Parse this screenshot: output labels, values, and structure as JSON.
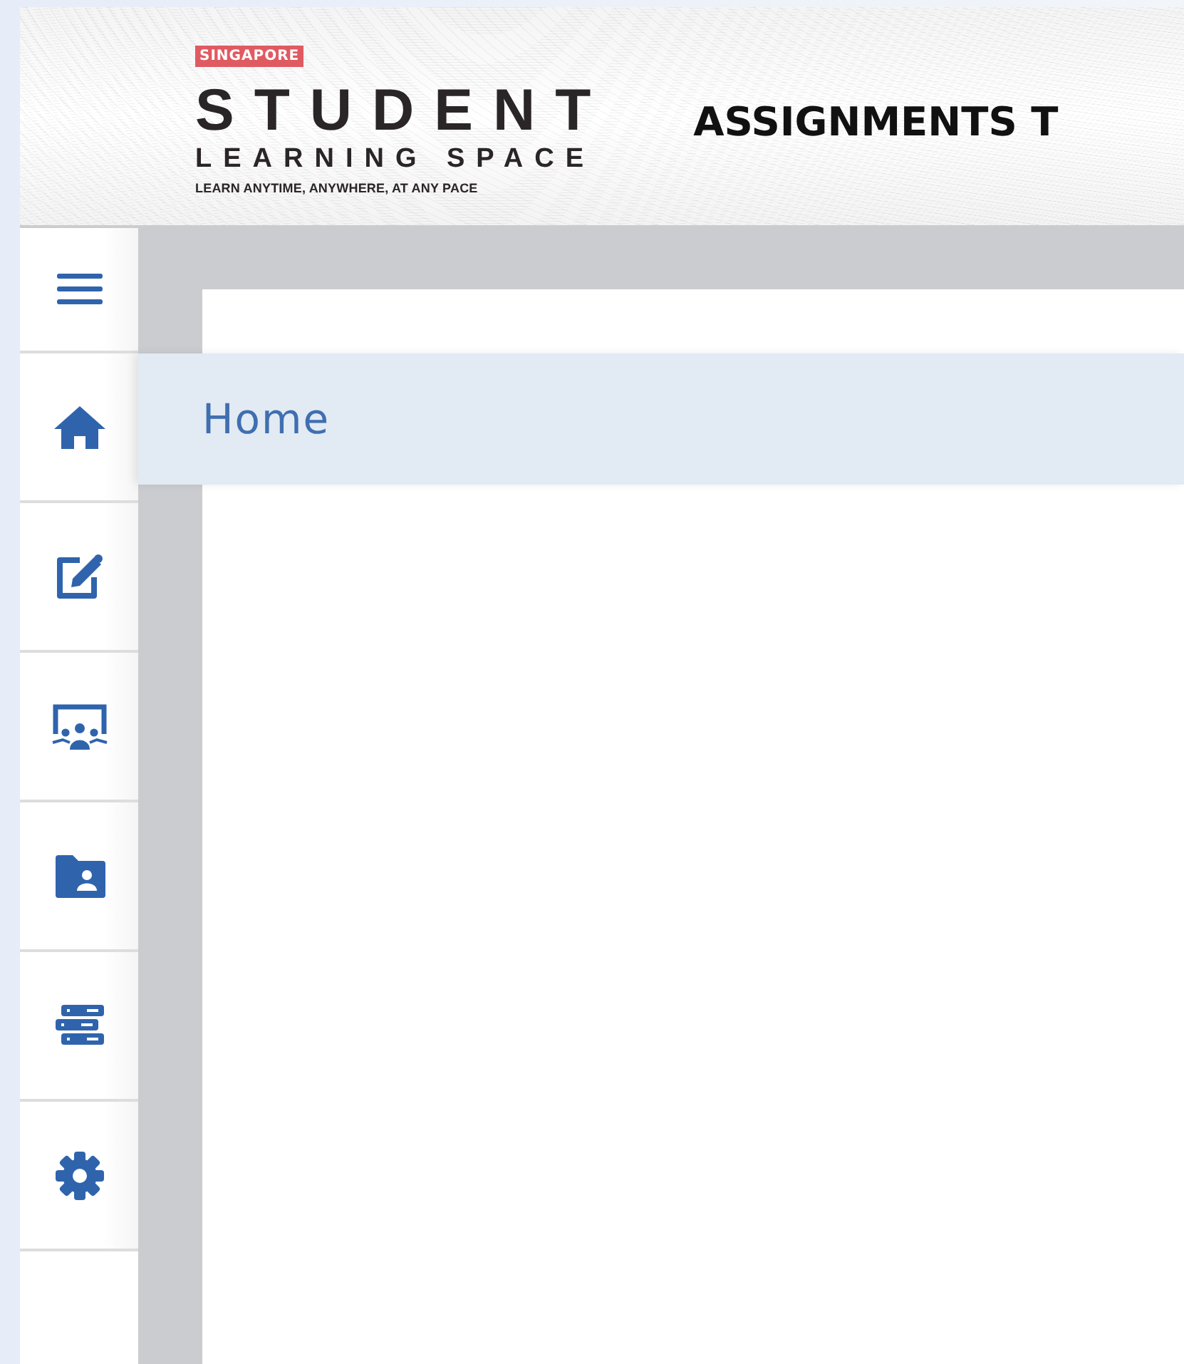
{
  "logo": {
    "badge": "SINGAPORE",
    "name": "STUDENT",
    "subtitle": "LEARNING SPACE",
    "tagline": "LEARN ANYTIME, ANYWHERE, AT ANY PACE"
  },
  "header": {
    "title": "ASSIGNMENTS T"
  },
  "sidebar": {
    "flyout": "Home"
  }
}
